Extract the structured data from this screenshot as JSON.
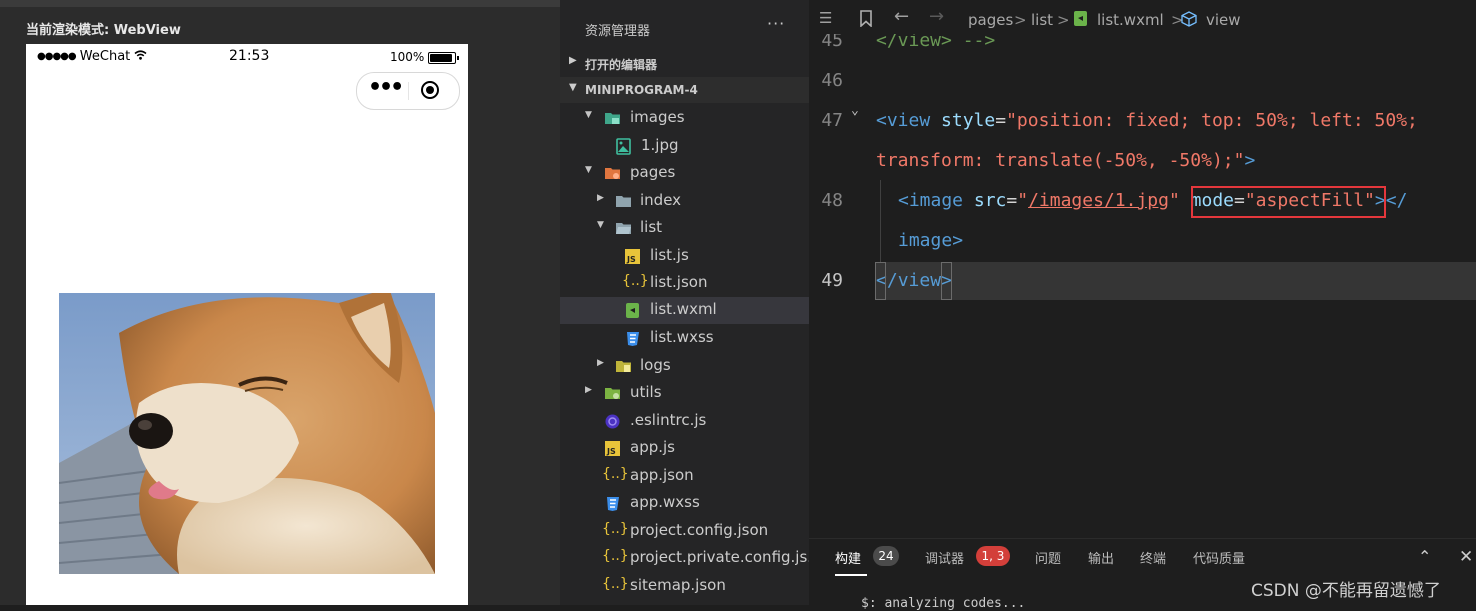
{
  "simulator": {
    "render_mode": "当前渲染模式: WebView",
    "carrier": "WeChat",
    "time": "21:53",
    "battery": "100%",
    "battery_level": 1.0
  },
  "explorer": {
    "title": "资源管理器",
    "more": "···",
    "open_editors": "打开的编辑器",
    "project": "MINIPROGRAM-4",
    "items": {
      "images": "images",
      "img1": "1.jpg",
      "pages": "pages",
      "index": "index",
      "list": "list",
      "list_js": "list.js",
      "list_json": "list.json",
      "list_wxml": "list.wxml",
      "list_wxss": "list.wxss",
      "logs": "logs",
      "utils": "utils",
      "eslintrc": ".eslintrc.js",
      "app_js": "app.js",
      "app_json": "app.json",
      "app_wxss": "app.wxss",
      "project_config": "project.config.json",
      "project_private": "project.private.config.js...",
      "sitemap": "sitemap.json"
    }
  },
  "editor": {
    "breadcrumb": [
      "pages",
      "list",
      "list.wxml",
      "view"
    ],
    "lines": {
      "n45": "45",
      "n46": "46",
      "n47": "47",
      "n48": "48",
      "n49": "49",
      "l45": "</view> -->",
      "l47_open": "<view",
      "l47_attr": " style",
      "l47_eq": "=",
      "l47_val": "\"position: fixed; top: 50%; left: 50%;",
      "l47b_val": "transform: translate(-50%, -50%);\"",
      "l47b_close": ">",
      "l48_open": "<image",
      "l48_src": " src",
      "l48_eq": "=",
      "l48_q1": "\"",
      "l48_path": "/images/1.jpg",
      "l48_q2": "\"",
      "l48_mode": " mode",
      "l48_eq2": "=",
      "l48_mval": "\"aspectFill\"",
      "l48_close": "></",
      "l48b_tag": "image",
      "l48b_close": ">",
      "l49_open": "</",
      "l49_tag": "view",
      "l49_close": ">"
    }
  },
  "panel": {
    "tabs": [
      "构建",
      "调试器",
      "问题",
      "输出",
      "终端",
      "代码质量"
    ],
    "build_count": "24",
    "debug_badge": "1, 3",
    "terminal_text": "$: analyzing codes...",
    "watermark": "CSDN @不能再留遗憾了"
  },
  "colors": {
    "tag": "#569cd6",
    "string": "#f07868",
    "comment": "#6a9955",
    "highlight_box": "#e5373c"
  }
}
